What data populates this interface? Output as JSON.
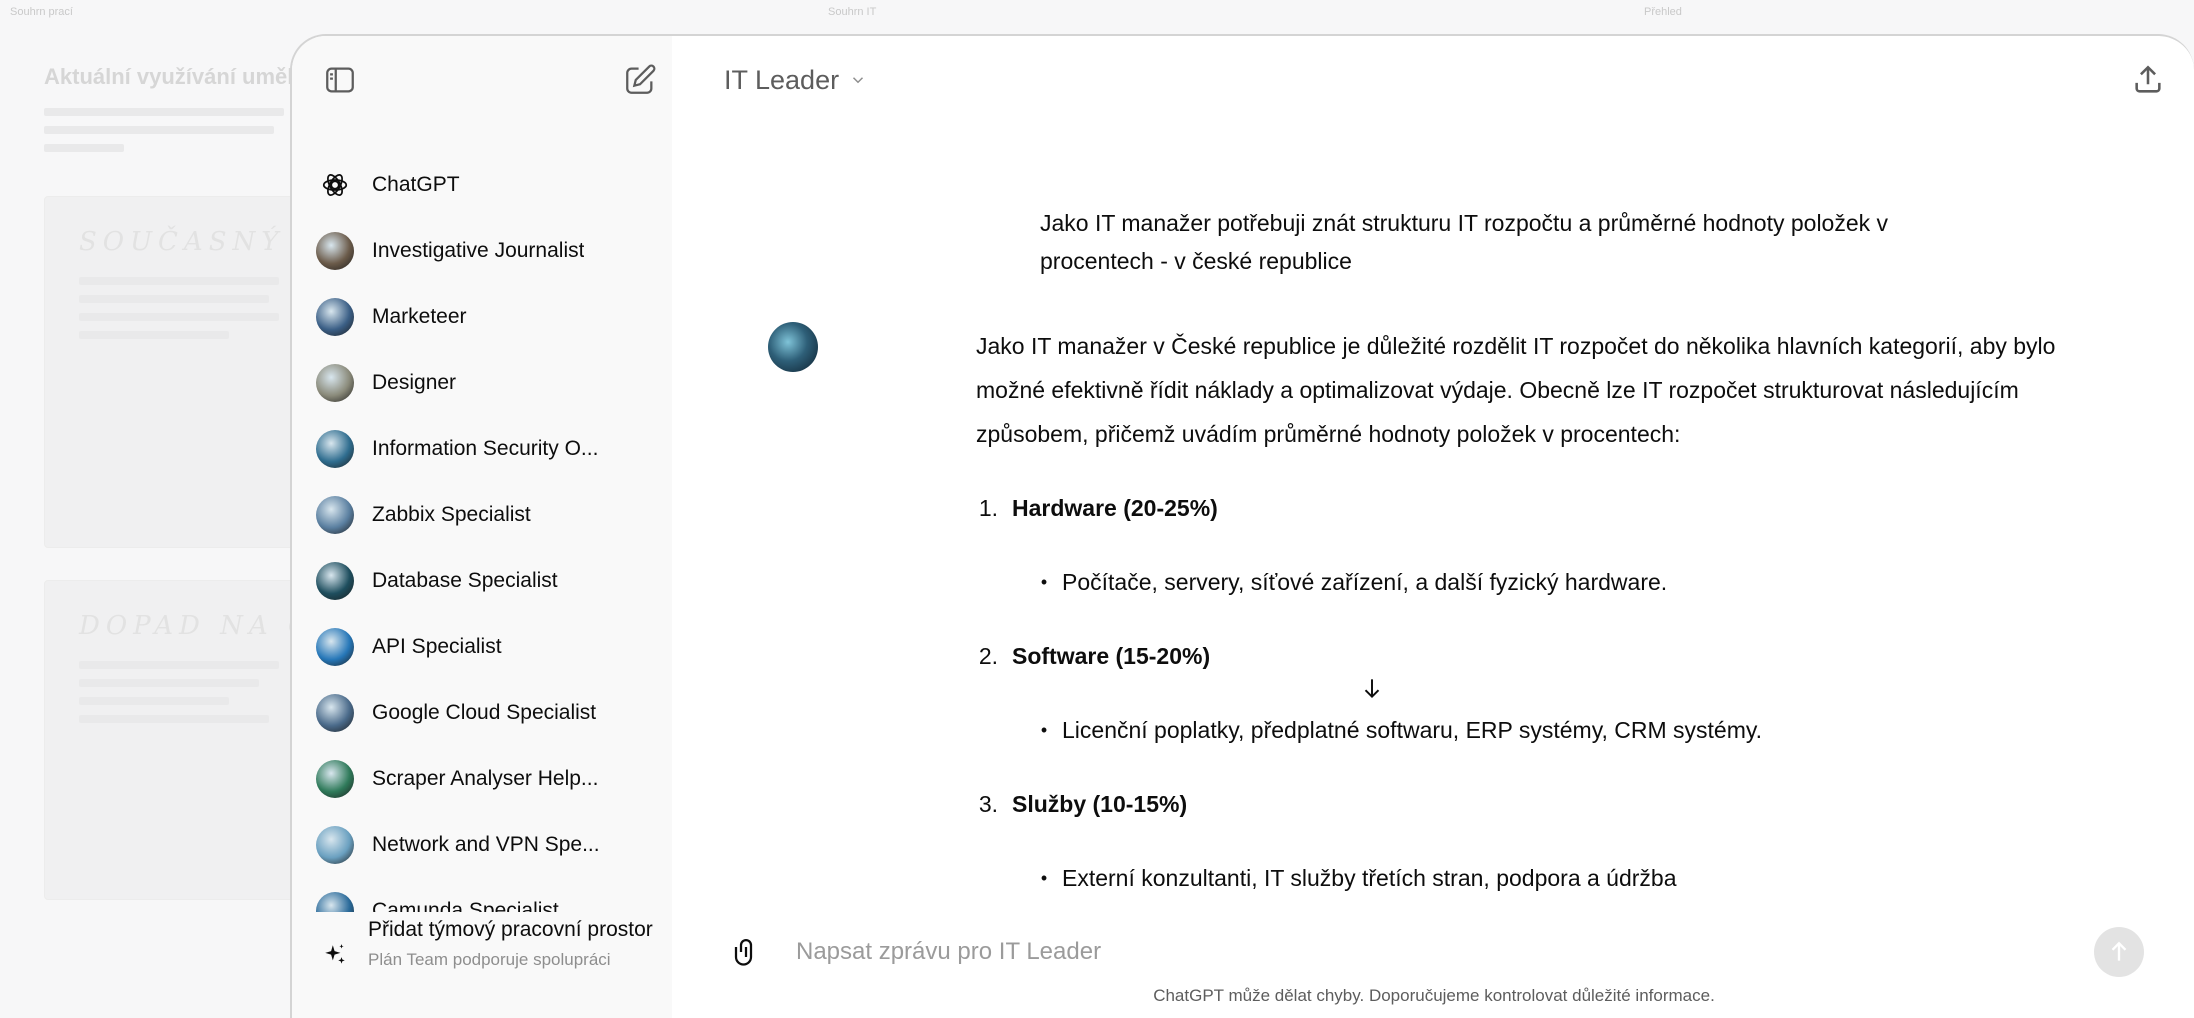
{
  "background": {
    "tabs": [
      "Souhrn prací",
      "Souhrn IT",
      "Přehled"
    ],
    "title": "Aktuální využívání uměl",
    "card1_title": "SOUČASNÝ STA",
    "card2_title": "DOPAD NA ORG"
  },
  "sidebar": {
    "gpts": [
      {
        "label": "ChatGPT",
        "icon": "openai-logo-icon",
        "color": "#0d0d0d"
      },
      {
        "label": "Investigative Journalist",
        "icon": "investigative-journalist-avatar",
        "color": "#6b5b4a"
      },
      {
        "label": "Marketeer",
        "icon": "marketeer-avatar",
        "color": "#3b5f86"
      },
      {
        "label": "Designer",
        "icon": "designer-avatar",
        "color": "#8a8a7a"
      },
      {
        "label": "Information Security O...",
        "icon": "information-security-avatar",
        "color": "#2f6d8f"
      },
      {
        "label": "Zabbix Specialist",
        "icon": "zabbix-specialist-avatar",
        "color": "#5a7fa0"
      },
      {
        "label": "Database Specialist",
        "icon": "database-specialist-avatar",
        "color": "#1e4e5e"
      },
      {
        "label": "API Specialist",
        "icon": "api-specialist-avatar",
        "color": "#2677b8"
      },
      {
        "label": "Google Cloud Specialist",
        "icon": "google-cloud-specialist-avatar",
        "color": "#4a6a8a"
      },
      {
        "label": "Scraper Analyser Help...",
        "icon": "scraper-analyser-avatar",
        "color": "#2f7a5a"
      },
      {
        "label": "Network and VPN Spe...",
        "icon": "network-vpn-avatar",
        "color": "#6aa0c0"
      },
      {
        "label": "Camunda Specialist",
        "icon": "camunda-specialist-avatar",
        "color": "#2a6a9a"
      }
    ],
    "team": {
      "title": "Přidat týmový pracovní prostor",
      "subtitle": "Plán Team podporuje spolupráci"
    }
  },
  "header": {
    "model_name": "IT Leader"
  },
  "chat": {
    "user_message": "Jako IT manažer potřebuji znát strukturu IT rozpočtu a průměrné hodnoty položek v procentech - v české republice",
    "assistant": {
      "intro": "Jako IT manažer v České republice je důležité rozdělit IT rozpočet do několika hlavních kategorií, aby bylo možné efektivně řídit náklady a optimalizovat výdaje. Obecně lze IT rozpočet strukturovat následujícím způsobem, přičemž uvádím průměrné hodnoty položek v procentech:",
      "items": [
        {
          "num": "1.",
          "title": "Hardware (20-25%)",
          "bullet": "Počítače, servery, síťové zařízení, a další fyzický hardware."
        },
        {
          "num": "2.",
          "title": "Software (15-20%)",
          "bullet": "Licenční poplatky, předplatné softwaru, ERP systémy, CRM systémy."
        },
        {
          "num": "3.",
          "title": "Služby (10-15%)",
          "bullet": "Externí konzultanti, IT služby třetích stran, podpora a údržba"
        }
      ]
    }
  },
  "composer": {
    "placeholder": "Napsat zprávu pro IT Leader"
  },
  "disclaimer": "ChatGPT může dělat chyby. Doporučujeme kontrolovat důležité informace."
}
